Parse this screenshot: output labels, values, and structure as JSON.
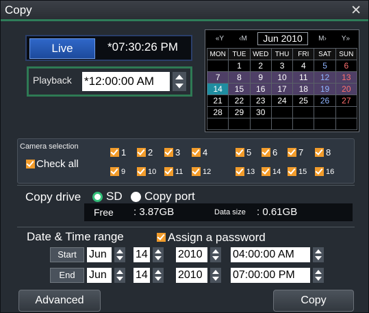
{
  "window": {
    "title": "Copy"
  },
  "live": {
    "button": "Live",
    "time": "*07:30:26 PM"
  },
  "playback": {
    "label": "Playback",
    "time": "*12:00:00 AM"
  },
  "calendar": {
    "prev_year": "«Y",
    "prev_month": "‹M",
    "month": "Jun 2010",
    "next_month": "M›",
    "next_year": "Y»",
    "weekdays": [
      "MON",
      "TUE",
      "WED",
      "THU",
      "FRI",
      "SAT",
      "SUN"
    ],
    "weeks": [
      [
        "",
        "1",
        "2",
        "3",
        "4",
        "5",
        "6"
      ],
      [
        "7",
        "8",
        "9",
        "10",
        "11",
        "12",
        "13"
      ],
      [
        "14",
        "15",
        "16",
        "17",
        "18",
        "19",
        "20"
      ],
      [
        "21",
        "22",
        "23",
        "24",
        "25",
        "26",
        "27"
      ],
      [
        "28",
        "29",
        "30",
        "",
        "",
        "",
        ""
      ],
      [
        "",
        "",
        "",
        "",
        "",
        "",
        ""
      ]
    ],
    "today": "14"
  },
  "camera": {
    "label": "Camera selection",
    "check_all": "Check all",
    "cams": [
      "1",
      "2",
      "3",
      "4",
      "5",
      "6",
      "7",
      "8",
      "9",
      "10",
      "11",
      "12",
      "13",
      "14",
      "15",
      "16"
    ]
  },
  "drive": {
    "label": "Copy drive",
    "opt_sd": "SD",
    "opt_port": "Copy port",
    "free_label": "Free",
    "free_value": ": 3.87GB",
    "size_label": "Data size",
    "size_value": ": 0.61GB"
  },
  "range": {
    "label": "Date & Time range",
    "password": "Assign a password",
    "start_label": "Start",
    "start": {
      "month": "Jun",
      "day": "14",
      "year": "2010",
      "time": "04:00:00 AM"
    },
    "end_label": "End",
    "end": {
      "month": "Jun",
      "day": "14",
      "year": "2010",
      "time": "07:00:00 PM"
    }
  },
  "buttons": {
    "advanced": "Advanced",
    "copy": "Copy"
  }
}
